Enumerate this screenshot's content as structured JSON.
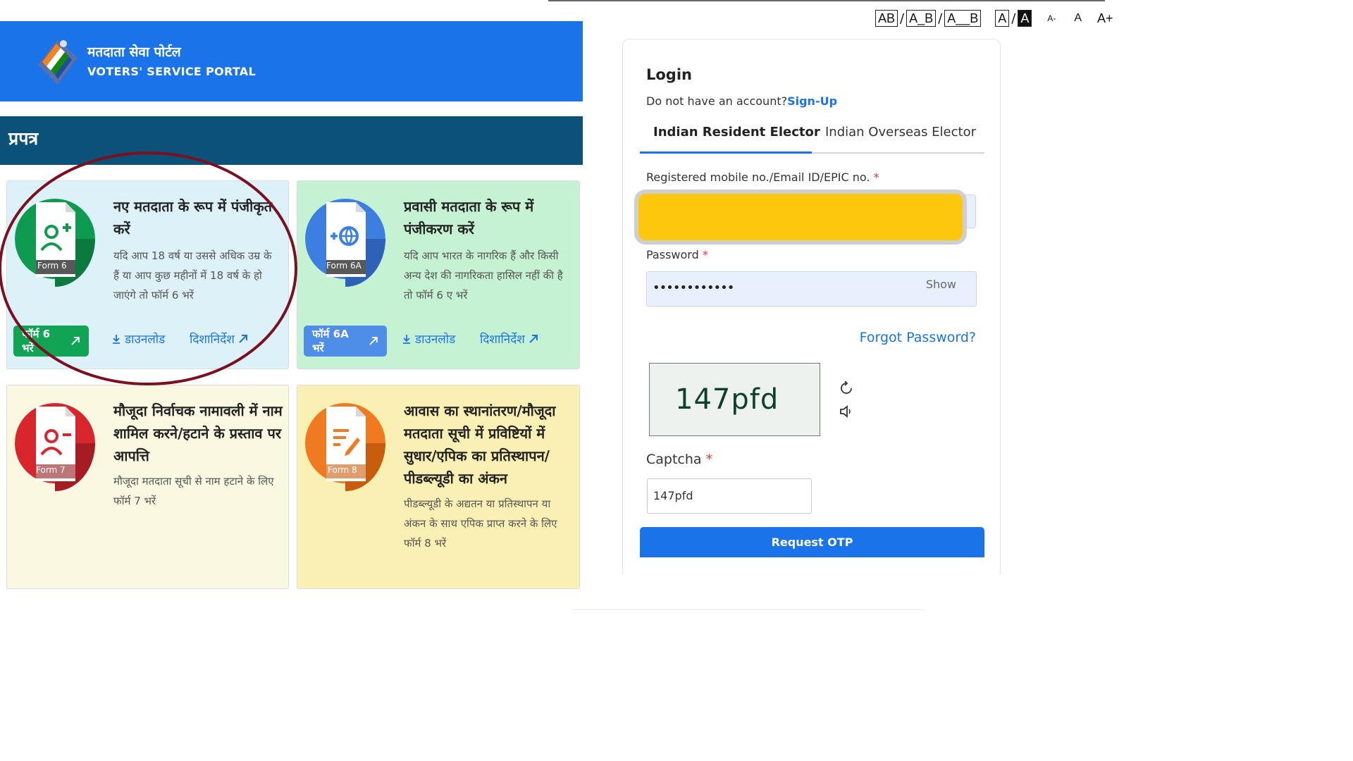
{
  "brand": {
    "title_hi": "मतदाता सेवा पोर्टल",
    "title_en": "VOTERS' SERVICE PORTAL"
  },
  "section": {
    "title": "प्रपत्र"
  },
  "cards": [
    {
      "form_label": "Form 6",
      "title": "नए मतदाता के रूप में पंजीकृत करें",
      "desc": "यदि आप 18 वर्ष या उससे अधिक उम्र के हैं या आप कुछ महीनों में 18 वर्ष के हो जाएंगे तो फॉर्म 6 भरें",
      "button": "फॉर्म 6 भरें",
      "download": "डाउनलोड",
      "guidelines": "दिशानिर्देश",
      "color": "#10a454"
    },
    {
      "form_label": "Form 6A",
      "title": "प्रवासी मतदाता के रूप में पंजीकरण करें",
      "desc": "यदि आप भारत के नागरिक हैं और किसी अन्य देश की नागरिकता हासिल नहीं की है तो फॉर्म 6 ए भरें",
      "button": "फॉर्म 6A भरें",
      "download": "डाउनलोड",
      "guidelines": "दिशानिर्देश",
      "color": "#3d7fe0"
    },
    {
      "form_label": "Form 7",
      "title": "मौजूदा निर्वाचक नामावली में नाम शामिल करने/हटाने के प्रस्ताव पर आपत्ति",
      "desc": "मौजूदा मतदाता सूची से नाम हटाने के लिए फॉर्म 7 भरें",
      "color": "#d8262c"
    },
    {
      "form_label": "Form 8",
      "title": "आवास का स्थानांतरण/मौजूदा मतदाता सूची में प्रविष्टियों में सुधार/एपिक का प्रतिस्थापन/ पीडब्ल्यूडी का अंकन",
      "desc": "पीडब्ल्यूडी के अद्यतन या प्रतिस्थापन या अंकन के साथ एपिक प्राप्त करने के लिए फॉर्म 8 भरें",
      "color": "#f07a20"
    }
  ],
  "a11y": {
    "spacing": [
      "AB",
      "A_B",
      "A__B"
    ],
    "contrast": [
      "A",
      "A"
    ],
    "sizes": [
      "A-",
      "A",
      "A+"
    ]
  },
  "login": {
    "title": "Login",
    "no_account": "Do not have an account?",
    "signup": "Sign-Up",
    "tabs": [
      "Indian Resident Elector",
      "Indian Overseas Elector"
    ],
    "mobile_label": "Registered mobile no./Email ID/EPIC no.",
    "password_label": "Password",
    "password_mask": "••••••••••••",
    "show": "Show",
    "forgot": "Forgot Password?",
    "captcha_image_text": "147pfd",
    "captcha_label": "Captcha",
    "captcha_value": "147pfd",
    "request_otp": "Request OTP",
    "required_mark": "*"
  }
}
